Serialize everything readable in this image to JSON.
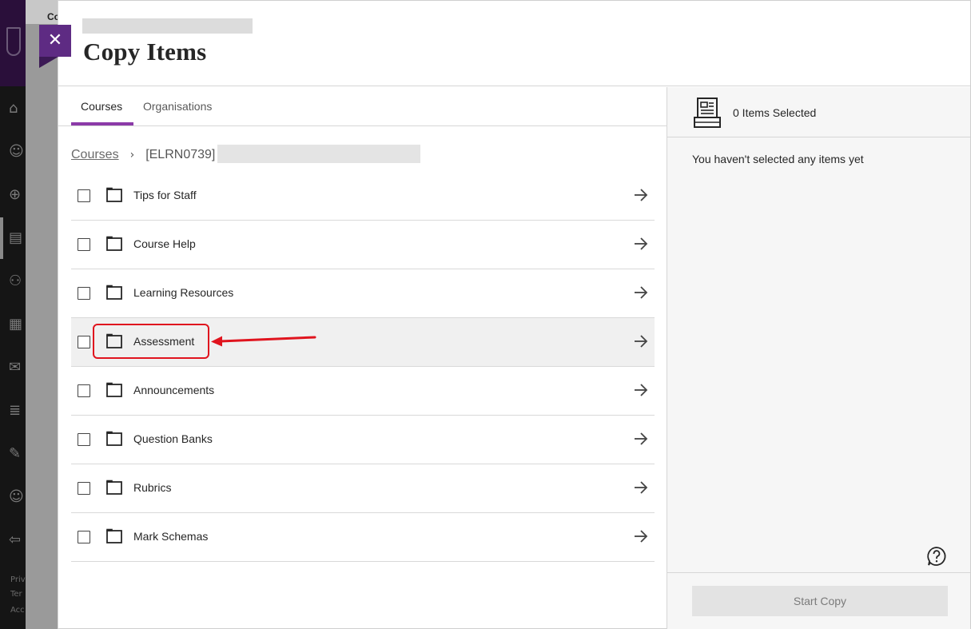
{
  "background": {
    "header_label": "Co",
    "footer_labels": [
      "Priv",
      "Ter",
      "Acc"
    ]
  },
  "panel": {
    "title": "Copy Items",
    "close_icon": "close-icon"
  },
  "tabs": [
    {
      "label": "Courses",
      "active": true
    },
    {
      "label": "Organisations",
      "active": false
    }
  ],
  "breadcrumb": {
    "link": "Courses",
    "current": "[ELRN0739]"
  },
  "items": [
    {
      "label": "Tips for Staff"
    },
    {
      "label": "Course Help"
    },
    {
      "label": "Learning Resources"
    },
    {
      "label": "Assessment",
      "highlighted": true
    },
    {
      "label": "Announcements"
    },
    {
      "label": "Question Banks"
    },
    {
      "label": "Rubrics"
    },
    {
      "label": "Mark Schemas"
    }
  ],
  "selection": {
    "count_label": "0 Items Selected",
    "empty_message": "You haven't selected any items yet",
    "start_button": "Start Copy"
  },
  "colors": {
    "accent": "#8b3aa8",
    "close_button": "#5e2b83",
    "annotation": "#e0141e"
  }
}
